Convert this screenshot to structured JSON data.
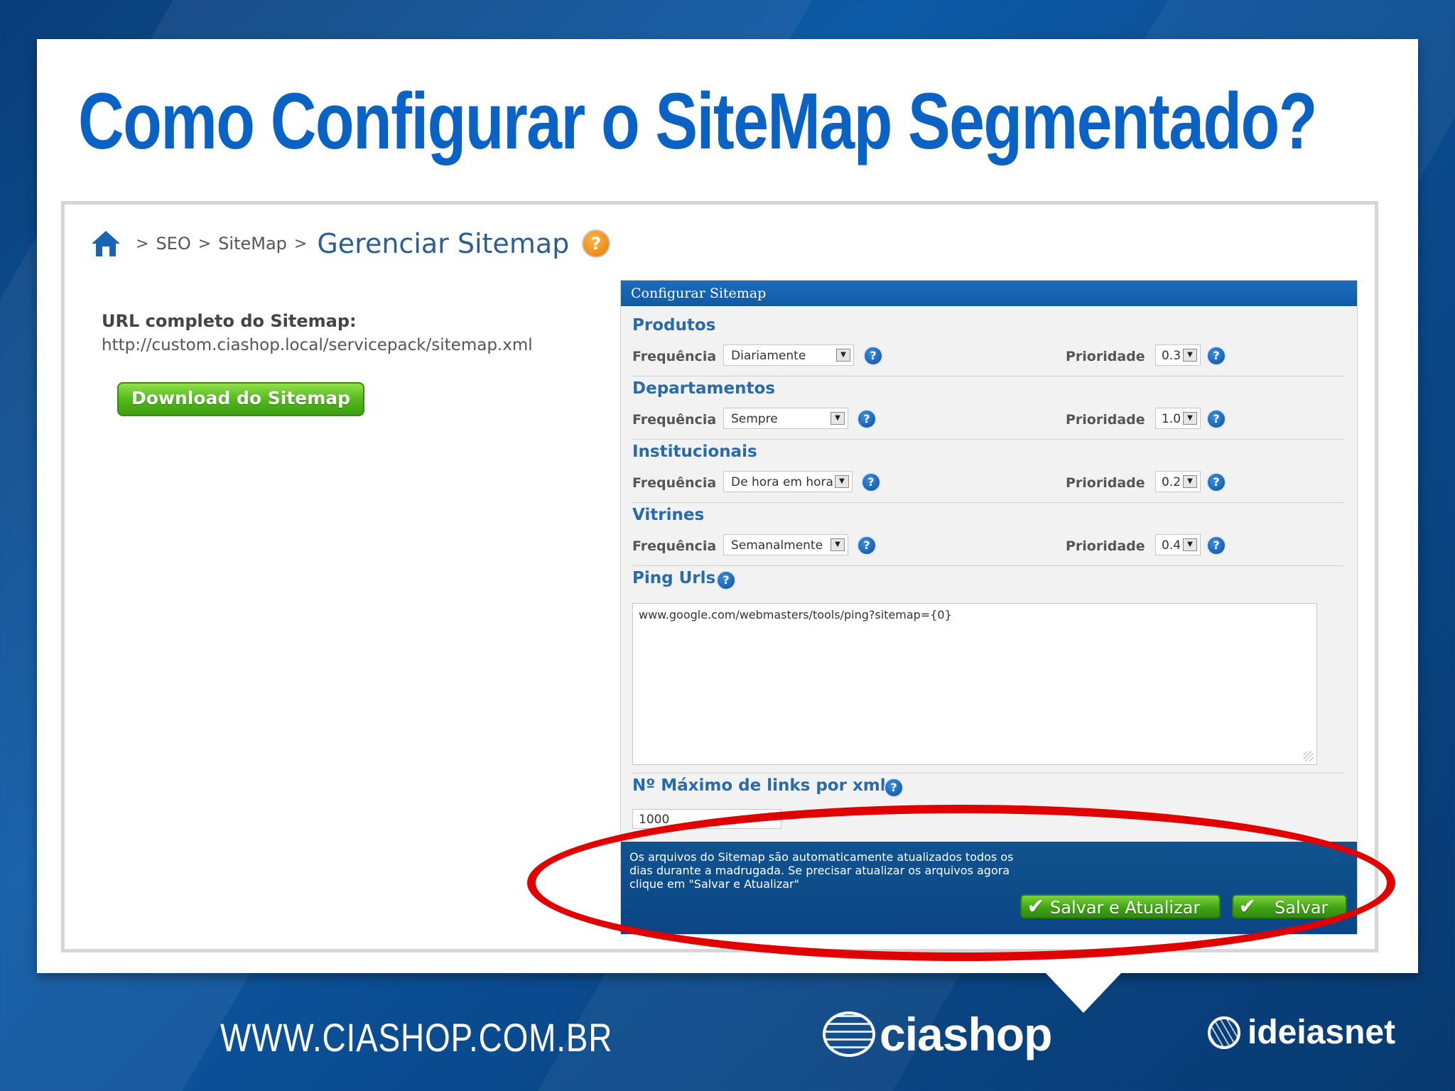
{
  "slide": {
    "title": "Como Configurar o SiteMap Segmentado?"
  },
  "breadcrumb": {
    "items": [
      "SEO",
      "SiteMap"
    ],
    "separator": ">",
    "current": "Gerenciar Sitemap",
    "help_icon": "question-orange-icon"
  },
  "left": {
    "url_label": "URL completo do Sitemap:",
    "url_value": "http://custom.ciashop.local/servicepack/sitemap.xml",
    "download_button": "Download do Sitemap"
  },
  "panel": {
    "title": "Configurar Sitemap",
    "freq_label": "Frequência",
    "priority_label": "Prioridade",
    "sections": [
      {
        "name": "Produtos",
        "frequency": "Diariamente",
        "priority": "0.3"
      },
      {
        "name": "Departamentos",
        "frequency": "Sempre",
        "priority": "1.0"
      },
      {
        "name": "Institucionais",
        "frequency": "De hora em hora",
        "priority": "0.2"
      },
      {
        "name": "Vitrines",
        "frequency": "Semanalmente",
        "priority": "0.4"
      }
    ],
    "ping_urls_label": "Ping Urls",
    "ping_urls_value": "www.google.com/webmasters/tools/ping?sitemap={0}",
    "max_links_label": "Nº Máximo de links por xml",
    "max_links_value": "1000",
    "footer_text": "Os arquivos do Sitemap são automaticamente atualizados todos os dias durante a madrugada. Se precisar atualizar os arquivos agora clique em \"Salvar e Atualizar\"",
    "save_update_button": "Salvar e Atualizar",
    "save_button": "Salvar"
  },
  "footer": {
    "url": "WWW.CIASHOP.COM.BR",
    "logo1": "ciashop",
    "logo2": "ideiasnet"
  },
  "colors": {
    "title_blue": "#0a63c4",
    "panel_blue": "#0f5aa6",
    "button_green": "#4fb71a",
    "highlight_red": "#e00000"
  }
}
